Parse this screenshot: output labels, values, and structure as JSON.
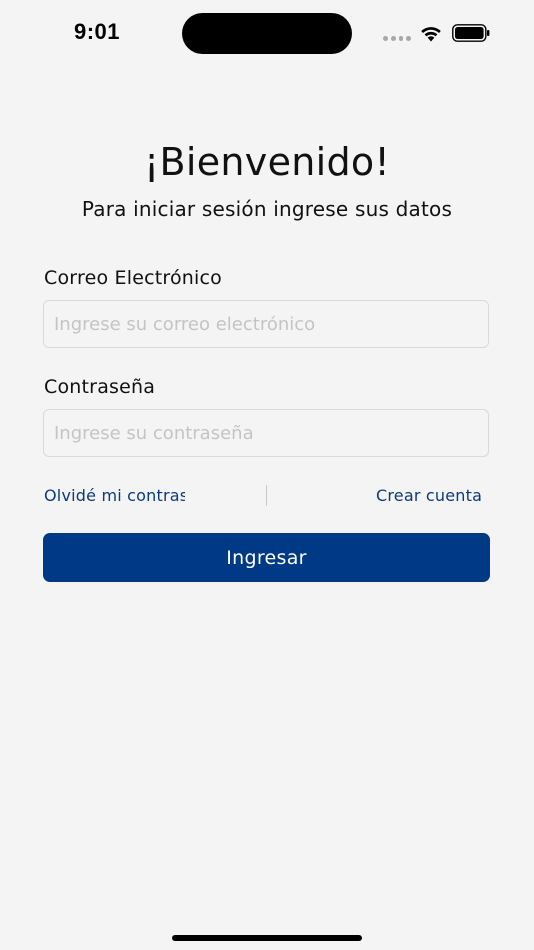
{
  "status_bar": {
    "time": "9:01",
    "icons": [
      "cellular-signal-icon",
      "wifi-icon",
      "battery-icon"
    ]
  },
  "login": {
    "title": "¡Bienvenido!",
    "subtitle": "Para iniciar sesión ingrese sus datos",
    "email": {
      "label": "Correo Electrónico",
      "placeholder": "Ingrese su correo electrónico",
      "value": ""
    },
    "password": {
      "label": "Contraseña",
      "placeholder": "Ingrese su contraseña",
      "value": ""
    },
    "forgot_link": "Olvidé mi contraseña",
    "create_link": "Crear cuenta",
    "submit_label": "Ingresar"
  },
  "colors": {
    "background": "#f4f4f4",
    "primary": "#003a87",
    "link": "#0b3b7e",
    "placeholder": "#c4c4c4"
  }
}
